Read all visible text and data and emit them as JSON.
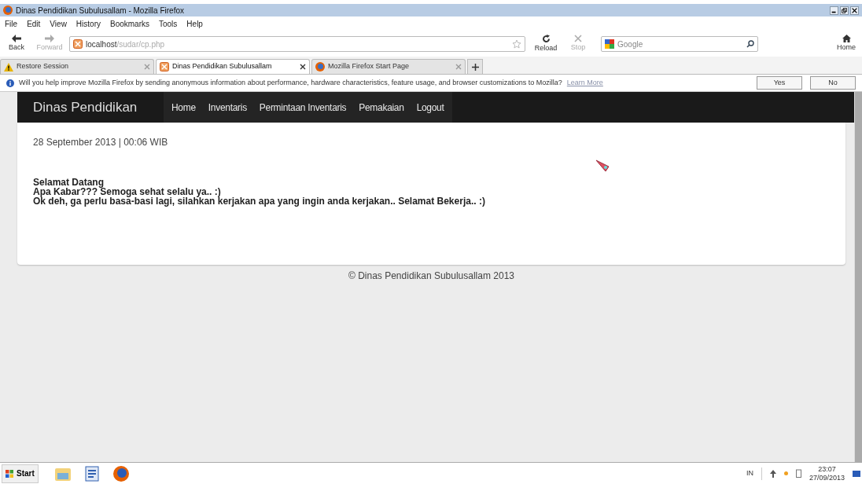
{
  "window": {
    "title": "Dinas Pendidikan Subulusallam - Mozilla Firefox"
  },
  "menu": [
    "File",
    "Edit",
    "View",
    "History",
    "Bookmarks",
    "Tools",
    "Help"
  ],
  "toolbar": {
    "back": "Back",
    "forward": "Forward",
    "url_host": "localhost",
    "url_path": "/sudar/cp.php",
    "reload": "Reload",
    "stop": "Stop",
    "search_placeholder": "Google",
    "home": "Home"
  },
  "tabs": [
    {
      "label": "Restore Session",
      "kind": "warning",
      "selected": false
    },
    {
      "label": "Dinas Pendidikan Subulusallam",
      "kind": "site",
      "selected": true
    },
    {
      "label": "Mozilla Firefox Start Page",
      "kind": "firefox",
      "selected": false
    }
  ],
  "notification": {
    "message": "Will you help improve Mozilla Firefox by sending anonymous information about performance, hardware characteristics, feature usage, and browser customizations to Mozilla?",
    "link": "Learn More",
    "buttons": [
      "Yes",
      "No"
    ]
  },
  "page": {
    "brand": "Dinas Pendidikan",
    "nav": [
      "Home",
      "Inventaris",
      "Permintaan Inventaris",
      "Pemakaian",
      "Logout"
    ],
    "date": "28 September 2013 | 00:06 WIB",
    "lines": [
      "Selamat Datang",
      "Apa Kabar??? Semoga sehat selalu ya.. :)",
      "Ok deh, ga perlu basa-basi lagi, silahkan kerjakan apa yang ingin anda kerjakan.. Selamat Bekerja.. :)"
    ],
    "footer": "© Dinas Pendidikan Subulusallam 2013"
  },
  "taskbar": {
    "start": "Start",
    "language": "IN",
    "time": "23:07",
    "date": "27/09/2013"
  }
}
